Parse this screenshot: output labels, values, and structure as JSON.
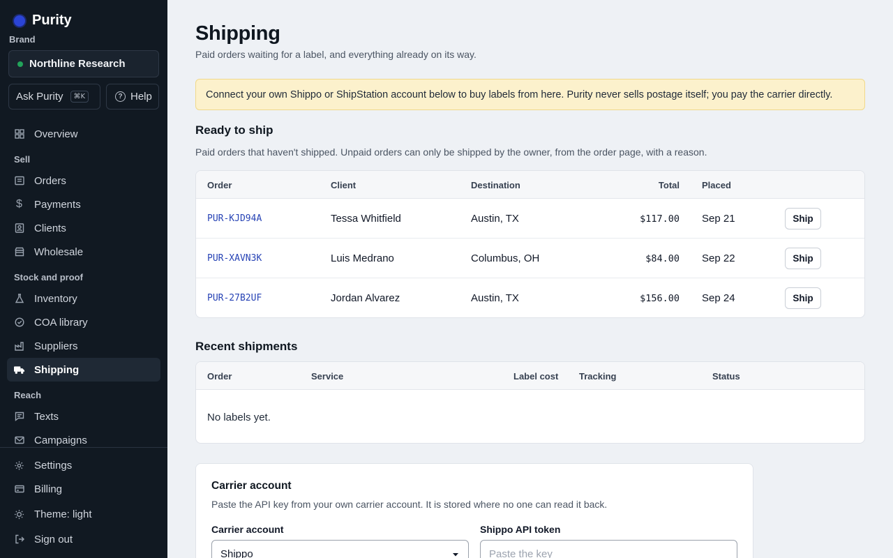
{
  "app": {
    "name": "Purity"
  },
  "brand": {
    "label": "Brand",
    "name": "Northline Research"
  },
  "quick": {
    "ask_label": "Ask Purity",
    "ask_shortcut": "⌘K",
    "help_label": "Help"
  },
  "nav": {
    "overview": "Overview",
    "sell_label": "Sell",
    "orders": "Orders",
    "payments": "Payments",
    "clients": "Clients",
    "wholesale": "Wholesale",
    "stock_label": "Stock and proof",
    "inventory": "Inventory",
    "coa": "COA library",
    "suppliers": "Suppliers",
    "shipping": "Shipping",
    "reach_label": "Reach",
    "texts": "Texts",
    "campaigns": "Campaigns",
    "settings": "Settings",
    "billing": "Billing",
    "theme": "Theme: light",
    "signout": "Sign out"
  },
  "page": {
    "title": "Shipping",
    "subtitle": "Paid orders waiting for a label, and everything already on its way.",
    "notice": "Connect your own Shippo or ShipStation account below to buy labels from here. Purity never sells postage itself; you pay the carrier directly."
  },
  "ready": {
    "title": "Ready to ship",
    "description": "Paid orders that haven't shipped. Unpaid orders can only be shipped by the owner, from the order page, with a reason.",
    "columns": {
      "order": "Order",
      "client": "Client",
      "destination": "Destination",
      "total": "Total",
      "placed": "Placed"
    },
    "rows": [
      {
        "order": "PUR-KJD94A",
        "client": "Tessa Whitfield",
        "destination": "Austin, TX",
        "total": "$117.00",
        "placed": "Sep 21",
        "action": "Ship"
      },
      {
        "order": "PUR-XAVN3K",
        "client": "Luis Medrano",
        "destination": "Columbus, OH",
        "total": "$84.00",
        "placed": "Sep 22",
        "action": "Ship"
      },
      {
        "order": "PUR-27B2UF",
        "client": "Jordan Alvarez",
        "destination": "Austin, TX",
        "total": "$156.00",
        "placed": "Sep 24",
        "action": "Ship"
      }
    ]
  },
  "recent": {
    "title": "Recent shipments",
    "columns": {
      "order": "Order",
      "service": "Service",
      "label_cost": "Label cost",
      "tracking": "Tracking",
      "status": "Status"
    },
    "empty": "No labels yet."
  },
  "carrier": {
    "title": "Carrier account",
    "description": "Paste the API key from your own carrier account. It is stored where no one can read it back.",
    "account_label": "Carrier account",
    "account_value": "Shippo",
    "token_label": "Shippo API token",
    "token_placeholder": "Paste the key"
  }
}
